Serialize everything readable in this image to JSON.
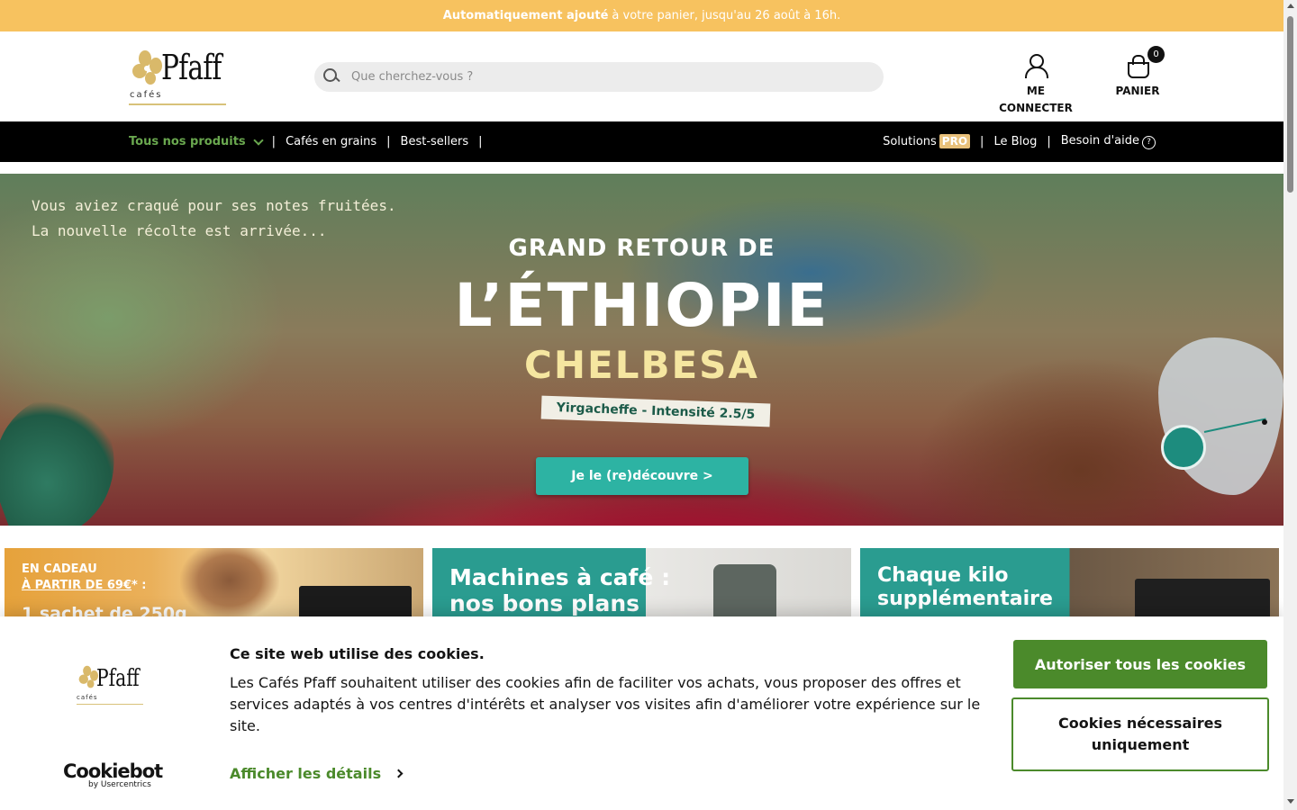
{
  "promo": {
    "bold": "Automatiquement ajouté",
    "text": "à votre panier, jusqu'au 26 août à 16h."
  },
  "header": {
    "logo_word": "Pfaff",
    "logo_small": "cafés",
    "search_placeholder": "Que cherchez-vous ?",
    "account_label": "ME CONNECTER",
    "cart_label": "PANIER",
    "cart_count": "0"
  },
  "nav": {
    "left": [
      {
        "label": "Tous nos produits"
      },
      {
        "label": "Cafés en grains"
      },
      {
        "label": "Best-sellers"
      }
    ],
    "right": [
      {
        "label": "Solutions",
        "badge": "PRO"
      },
      {
        "label": "Le Blog"
      },
      {
        "label": "Besoin d'aide",
        "icon": "?"
      }
    ],
    "separator": "|"
  },
  "hero": {
    "tagline_1": "Vous aviez craqué pour ses notes fruitées.",
    "tagline_2": "La nouvelle récolte est arrivée...",
    "title_1": "GRAND RETOUR DE",
    "title_2": "L’ÉTHIOPIE",
    "title_3": "CHELBESA",
    "subtitle": "Yirgacheffe - Intensité 2.5/5",
    "cta": "Je le (re)découvre >"
  },
  "cards": [
    {
      "line1": "EN CADEAU",
      "line2": "À PARTIR DE 69€",
      "line2_suffix": "* :",
      "line3": "1 sachet de 250g"
    },
    {
      "line1": "Machines à café :",
      "line2": "nos bons plans"
    },
    {
      "line1": "Chaque kilo",
      "line2": "supplémentaire"
    }
  ],
  "cookie": {
    "logo_word": "Pfaff",
    "logo_small": "cafés",
    "title": "Ce site web utilise des cookies.",
    "body": "Les Cafés Pfaff souhaitent utiliser des cookies afin de faciliter vos achats, vous proposer des offres et services adaptés à vos centres d'intérêts et analyser vos visites afin d'améliorer votre expérience sur le site.",
    "details": "Afficher les détails",
    "cookiebot": "Cookiebot",
    "cookiebot_sub": "by Usercentrics",
    "btn_all": "Autoriser tous les cookies",
    "btn_necessary": "Cookies nécessaires uniquement"
  },
  "colors": {
    "promo": "#f7c25f",
    "nav": "#000000",
    "accent_green": "#4b8a2b",
    "teal": "#2db3a3"
  }
}
